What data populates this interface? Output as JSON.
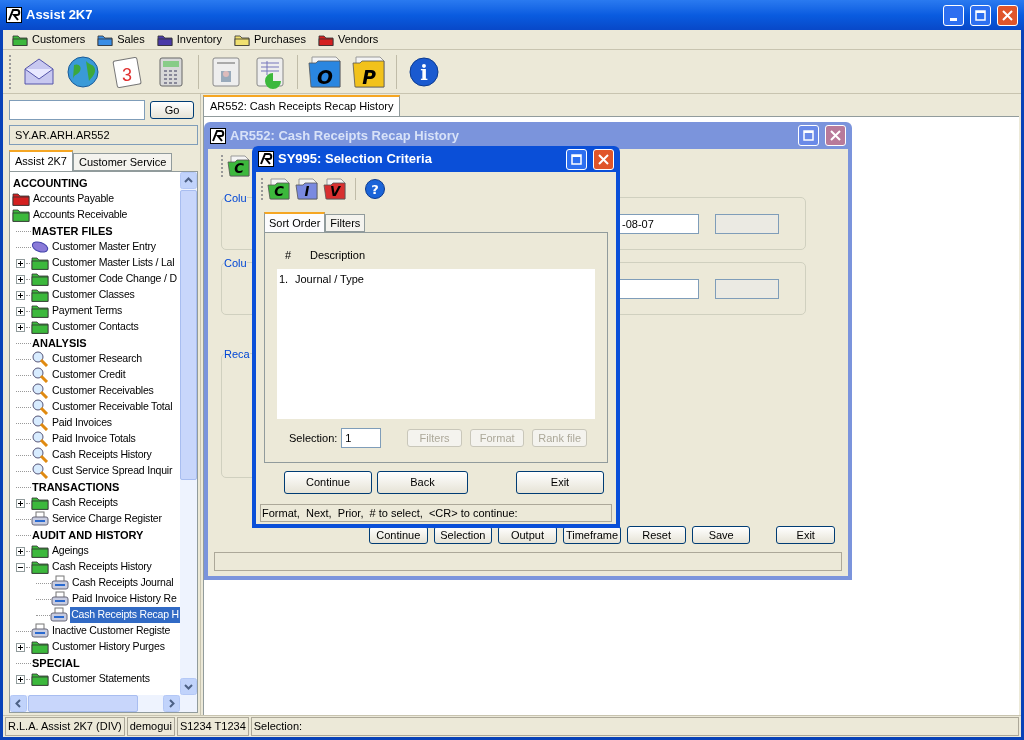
{
  "window": {
    "title": "Assist 2K7"
  },
  "menu": [
    {
      "label": "Customers",
      "color": "#3cb83c"
    },
    {
      "label": "Sales",
      "color": "#3a8ee6"
    },
    {
      "label": "Inventory",
      "color": "#4a3aa8"
    },
    {
      "label": "Purchases",
      "color": "#f0e070"
    },
    {
      "label": "Vendors",
      "color": "#d42020"
    }
  ],
  "toolbar": [
    {
      "kind": "envelope"
    },
    {
      "kind": "globe"
    },
    {
      "kind": "calendar",
      "label": "3"
    },
    {
      "kind": "calculator",
      "separator_after": true
    },
    {
      "kind": "card"
    },
    {
      "kind": "sheet",
      "separator_after": true
    },
    {
      "kind": "letter-folder",
      "label": "O",
      "color": "#2a86e0"
    },
    {
      "kind": "letter-folder",
      "label": "P",
      "color": "#f2c21b",
      "separator_after": true
    },
    {
      "kind": "info",
      "label": "i"
    }
  ],
  "sidebar": {
    "go_button": "Go",
    "path": "SY.AR.ARH.AR552",
    "tabs": [
      {
        "label": "Assist 2K7",
        "selected": true
      },
      {
        "label": "Customer Service",
        "selected": false
      }
    ],
    "tree": [
      {
        "kind": "heading",
        "label": "ACCOUNTING"
      },
      {
        "kind": "folder",
        "label": "Accounts Payable",
        "color": "#d42020",
        "selected": false
      },
      {
        "kind": "folder",
        "label": "Accounts Receivable",
        "color": "#3cb83c",
        "selected": false,
        "children": [
          {
            "kind": "heading",
            "label": "MASTER FILES"
          },
          {
            "kind": "entry",
            "label": "Customer Master Entry",
            "selected": false
          },
          {
            "kind": "folder",
            "label": "Customer Master Lists / Lal",
            "color": "#3cb83c",
            "expanded": false,
            "selected": false
          },
          {
            "kind": "folder",
            "label": "Customer Code Change / D",
            "color": "#3cb83c",
            "expanded": false,
            "selected": false
          },
          {
            "kind": "folder",
            "label": "Customer Classes",
            "color": "#3cb83c",
            "expanded": false,
            "selected": false
          },
          {
            "kind": "folder",
            "label": "Payment Terms",
            "color": "#3cb83c",
            "expanded": false,
            "selected": false
          },
          {
            "kind": "folder",
            "label": "Customer Contacts",
            "color": "#3cb83c",
            "expanded": false,
            "selected": false
          },
          {
            "kind": "heading",
            "label": "ANALYSIS"
          },
          {
            "kind": "search",
            "label": "Customer Research",
            "selected": false
          },
          {
            "kind": "search",
            "label": "Customer Credit",
            "selected": false
          },
          {
            "kind": "search",
            "label": "Customer Receivables",
            "selected": false
          },
          {
            "kind": "search",
            "label": "Customer Receivable Total",
            "selected": false
          },
          {
            "kind": "search",
            "label": "Paid Invoices",
            "selected": false
          },
          {
            "kind": "search",
            "label": "Paid Invoice Totals",
            "selected": false
          },
          {
            "kind": "search",
            "label": "Cash Receipts History",
            "selected": false
          },
          {
            "kind": "search",
            "label": "Cust Service Spread Inquir",
            "selected": false
          },
          {
            "kind": "heading",
            "label": "TRANSACTIONS"
          },
          {
            "kind": "folder",
            "label": "Cash Receipts",
            "color": "#3cb83c",
            "expanded": false,
            "selected": false
          },
          {
            "kind": "print",
            "label": "Service Charge Register",
            "selected": false
          },
          {
            "kind": "heading",
            "label": "AUDIT AND HISTORY"
          },
          {
            "kind": "folder",
            "label": "Ageings",
            "color": "#3cb83c",
            "expanded": false,
            "selected": false
          },
          {
            "kind": "folder",
            "label": "Cash Receipts History",
            "color": "#3cb83c",
            "expanded": true,
            "selected": false,
            "children": [
              {
                "kind": "print",
                "label": "Cash Receipts Journal",
                "selected": false
              },
              {
                "kind": "print",
                "label": "Paid Invoice History Re",
                "selected": false
              },
              {
                "kind": "print",
                "label": "Cash Receipts Recap H",
                "selected": true
              }
            ]
          },
          {
            "kind": "print",
            "label": "Inactive Customer Registe",
            "selected": false
          },
          {
            "kind": "folder",
            "label": "Customer History Purges",
            "color": "#3cb83c",
            "expanded": false,
            "selected": false
          },
          {
            "kind": "heading",
            "label": "SPECIAL"
          },
          {
            "kind": "folder",
            "label": "Customer Statements",
            "color": "#3cb83c",
            "expanded": false,
            "selected": false
          }
        ]
      }
    ]
  },
  "content_tab": {
    "label": "AR552: Cash Receipts Recap History",
    "selected": true
  },
  "report_window": {
    "title": "AR552: Cash Receipts Recap History",
    "toolbar_icon": "C",
    "groups": [
      {
        "label": "Colu",
        "value": "-08-07"
      },
      {
        "label": "Colu"
      },
      {
        "label": "Reca"
      }
    ],
    "buttons": [
      "Continue",
      "Selection",
      "Output",
      "Timeframe",
      "Reset",
      "Save",
      "Exit"
    ]
  },
  "dialog": {
    "title": "SY995: Selection Criteria",
    "toolbar": [
      {
        "kind": "letter-folder",
        "label": "C",
        "color": "#3cb83c"
      },
      {
        "kind": "letter-folder",
        "label": "I",
        "color": "#7a8ae0"
      },
      {
        "kind": "letter-folder",
        "label": "V",
        "color": "#d83030",
        "separator_after": true
      },
      {
        "kind": "help",
        "label": "?"
      }
    ],
    "tabs": [
      {
        "label": "Sort Order",
        "selected": true
      },
      {
        "label": "Filters",
        "selected": false
      }
    ],
    "columns": [
      "#",
      "Description"
    ],
    "rows": [
      {
        "number": "1.",
        "description": "Journal / Type"
      }
    ],
    "selection_label": "Selection:",
    "selection_value": "1",
    "tool_buttons": [
      {
        "label": "Filters",
        "disabled": true
      },
      {
        "label": "Format",
        "disabled": true
      },
      {
        "label": "Rank file",
        "disabled": true
      }
    ],
    "buttons": [
      "Continue",
      "Back",
      "Exit"
    ],
    "status": "Format,  Next,  Prior,  # to select,  <CR> to continue:"
  },
  "status_bar": [
    "R.L.A. Assist 2K7 (DIV)",
    "demogui",
    "S1234 T1234",
    "Selection:"
  ]
}
